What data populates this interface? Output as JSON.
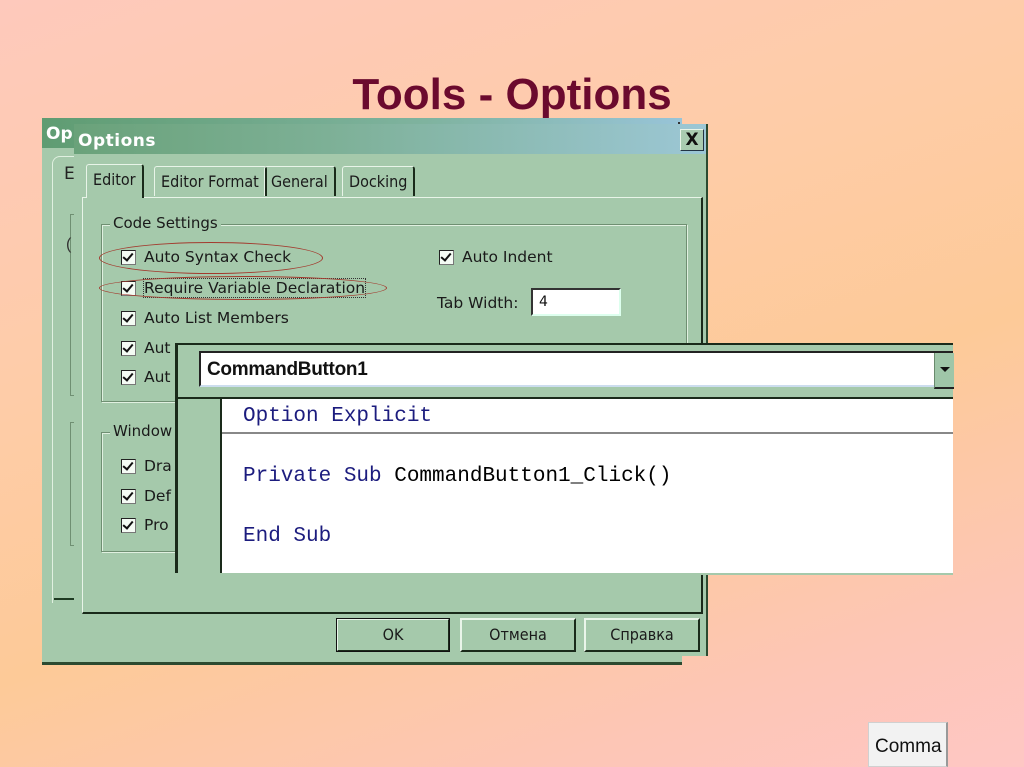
{
  "slide": {
    "title": "Tools - Options"
  },
  "back_window": {
    "title_fragment": "Op",
    "tab_fragment": "E",
    "paren": "("
  },
  "dialog": {
    "title": "Options",
    "close_label": "X",
    "tabs": [
      {
        "label": "Editor",
        "active": true
      },
      {
        "label": "Editor Format",
        "active": false
      },
      {
        "label": "General",
        "active": false
      },
      {
        "label": "Docking",
        "active": false
      }
    ],
    "code_settings": {
      "label": "Code Settings",
      "options": [
        {
          "label": "Auto Syntax Check",
          "checked": true,
          "highlighted": true
        },
        {
          "label": "Require Variable Declaration",
          "checked": true,
          "highlighted": true
        },
        {
          "label": "Auto List Members",
          "checked": true
        },
        {
          "label": "Aut",
          "checked": true
        },
        {
          "label": "Aut",
          "checked": true
        }
      ],
      "auto_indent": {
        "label": "Auto Indent",
        "checked": true
      },
      "tab_width": {
        "label": "Tab Width:",
        "value": "4"
      }
    },
    "window_settings": {
      "label": "Window",
      "options": [
        {
          "label": "Dra",
          "checked": true
        },
        {
          "label": "Def",
          "checked": true
        },
        {
          "label": "Pro",
          "checked": true
        }
      ]
    },
    "buttons": {
      "ok": "OK",
      "cancel": "Отмена",
      "help": "Справка"
    }
  },
  "code_window": {
    "object": "CommandButton1",
    "lines": [
      {
        "kw": "Option Explicit",
        "rest": ""
      },
      {
        "kw": "Private Sub",
        "rest": " CommandButton1_Click()"
      },
      {
        "kw": "End Sub",
        "rest": ""
      }
    ]
  },
  "corner_button": {
    "label": "Comma"
  },
  "colors": {
    "title": "#6b0a2e",
    "dialog_bg": "#a5c9ab",
    "keyword": "#1c1c7e",
    "highlight_ellipse": "#a33a2e"
  }
}
